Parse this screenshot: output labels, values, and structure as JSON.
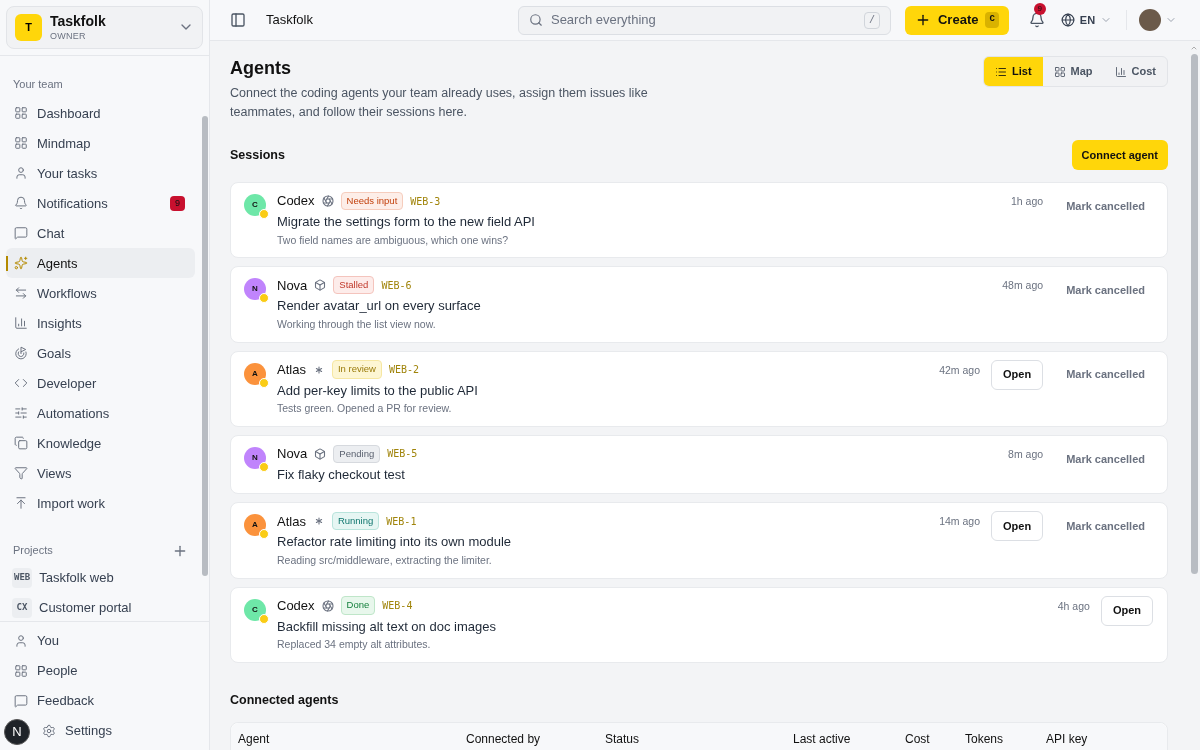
{
  "workspace": {
    "initial": "T",
    "name": "Taskfolk",
    "role": "OWNER"
  },
  "sidebar": {
    "team_heading": "Your team",
    "items": [
      {
        "label": "Dashboard",
        "selected": false
      },
      {
        "label": "Mindmap",
        "selected": false
      },
      {
        "label": "Your tasks",
        "selected": false
      },
      {
        "label": "Notifications",
        "selected": false,
        "badge": "9"
      },
      {
        "label": "Chat",
        "selected": false
      },
      {
        "label": "Agents",
        "selected": true
      },
      {
        "label": "Workflows",
        "selected": false
      },
      {
        "label": "Insights",
        "selected": false
      },
      {
        "label": "Goals",
        "selected": false
      },
      {
        "label": "Developer",
        "selected": false
      },
      {
        "label": "Automations",
        "selected": false
      },
      {
        "label": "Knowledge",
        "selected": false
      },
      {
        "label": "Views",
        "selected": false
      },
      {
        "label": "Import work",
        "selected": false
      }
    ],
    "projects_heading": "Projects",
    "projects": [
      {
        "code": "WEB",
        "label": "Taskfolk web"
      },
      {
        "code": "CX",
        "label": "Customer portal"
      }
    ],
    "bottom_items": [
      {
        "label": "You"
      },
      {
        "label": "People"
      },
      {
        "label": "Feedback"
      },
      {
        "label": "Settings"
      }
    ],
    "floating_button": "N"
  },
  "topbar": {
    "title": "Taskfolk",
    "search_placeholder": "Search everything",
    "search_key": "/",
    "create_label": "Create",
    "create_key": "C",
    "notification_count": "9",
    "language": "EN"
  },
  "page": {
    "title": "Agents",
    "description": "Connect the coding agents your team already uses, assign them issues like teammates, and follow their sessions here.",
    "views": [
      {
        "label": "List",
        "selected": true
      },
      {
        "label": "Map",
        "selected": false
      },
      {
        "label": "Cost",
        "selected": false
      }
    ]
  },
  "sessions": {
    "heading": "Sessions",
    "connect_label": "Connect agent",
    "items": [
      {
        "initial": "C",
        "color": "#6ee7a8",
        "agent": "Codex",
        "status": "Needs input",
        "kind": "needs_input",
        "issue": "WEB-3",
        "title": "Migrate the settings form to the new field API",
        "detail": "Two field names are ambiguous, which one wins?",
        "time": "1h ago",
        "open": false,
        "cancel_label": "Mark cancelled"
      },
      {
        "initial": "N",
        "color": "#c084fc",
        "agent": "Nova",
        "status": "Stalled",
        "kind": "stalled",
        "issue": "WEB-6",
        "title": "Render avatar_url on every surface",
        "detail": "Working through the list view now.",
        "time": "48m ago",
        "open": false,
        "cancel_label": "Mark cancelled"
      },
      {
        "initial": "A",
        "color": "#fb923c",
        "agent": "Atlas",
        "status": "In review",
        "kind": "in_review",
        "issue": "WEB-2",
        "title": "Add per-key limits to the public API",
        "detail": "Tests green. Opened a PR for review.",
        "time": "42m ago",
        "open": true,
        "open_label": "Open",
        "cancel_label": "Mark cancelled"
      },
      {
        "initial": "N",
        "color": "#c084fc",
        "agent": "Nova",
        "status": "Pending",
        "kind": "pending",
        "issue": "WEB-5",
        "title": "Fix flaky checkout test",
        "time": "8m ago",
        "open": false,
        "cancel_label": "Mark cancelled"
      },
      {
        "initial": "A",
        "color": "#fb923c",
        "agent": "Atlas",
        "status": "Running",
        "kind": "running",
        "issue": "WEB-1",
        "title": "Refactor rate limiting into its own module",
        "detail": "Reading src/middleware, extracting the limiter.",
        "time": "14m ago",
        "open": true,
        "open_label": "Open",
        "cancel_label": "Mark cancelled"
      },
      {
        "initial": "C",
        "color": "#6ee7a8",
        "agent": "Codex",
        "status": "Done",
        "kind": "done",
        "issue": "WEB-4",
        "title": "Backfill missing alt text on doc images",
        "detail": "Replaced 34 empty alt attributes.",
        "time": "4h ago",
        "open": true,
        "open_label": "Open"
      }
    ]
  },
  "connected": {
    "heading": "Connected agents",
    "columns": [
      "Agent",
      "Connected by",
      "Status",
      "Last active",
      "Cost",
      "Tokens",
      "API key"
    ]
  }
}
